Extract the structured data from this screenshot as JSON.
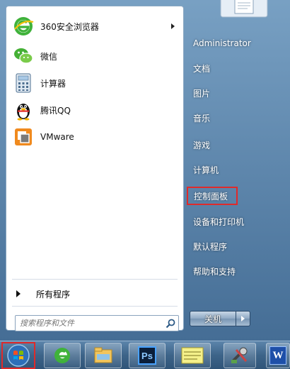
{
  "pinned_apps": [
    {
      "label": "360安全浏览器",
      "icon": "360-browser-icon",
      "has_submenu": true
    },
    {
      "label": "微信",
      "icon": "wechat-icon"
    },
    {
      "label": "计算器",
      "icon": "calculator-icon"
    },
    {
      "label": "腾讯QQ",
      "icon": "qq-penguin-icon"
    },
    {
      "label": "VMware",
      "icon": "vmware-icon"
    }
  ],
  "all_programs_label": "所有程序",
  "search": {
    "placeholder": "搜索程序和文件"
  },
  "right_items": [
    {
      "label": "Administrator"
    },
    {
      "label": "文档"
    },
    {
      "label": "图片"
    },
    {
      "label": "音乐"
    },
    {
      "label": "游戏"
    },
    {
      "label": "计算机"
    },
    {
      "label": "控制面板",
      "highlighted": true
    },
    {
      "label": "设备和打印机"
    },
    {
      "label": "默认程序"
    },
    {
      "label": "帮助和支持"
    }
  ],
  "shutdown_label": "关机",
  "taskbar_items": [
    {
      "name": "ie-icon"
    },
    {
      "name": "file-explorer-icon"
    },
    {
      "name": "photoshop-icon"
    },
    {
      "name": "notes-icon"
    },
    {
      "name": "tools-icon"
    },
    {
      "name": "word-icon"
    }
  ],
  "taskbar_ps_text": "Ps",
  "taskbar_word_text": "W",
  "colors": {
    "highlight_border": "#e02a2a",
    "accent": "#3d6489"
  }
}
